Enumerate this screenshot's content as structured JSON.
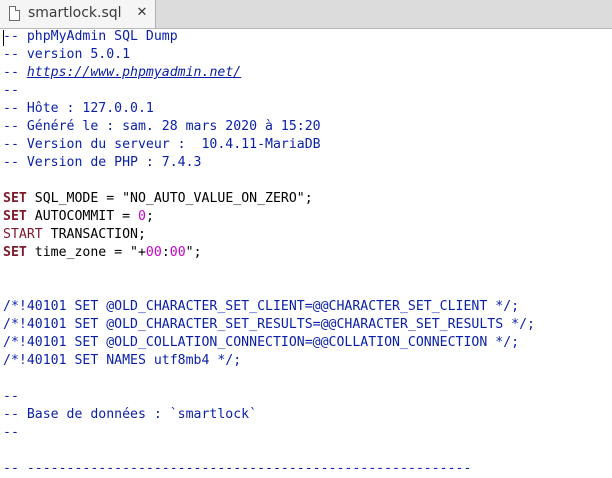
{
  "tab": {
    "title": "smartlock.sql",
    "close_glyph": "✕",
    "icon": "text-file-icon"
  },
  "colors": {
    "comment": "#0a1fa8",
    "keyword": "#7d1a2b",
    "number": "#c900c9",
    "text": "#000000"
  },
  "editor": {
    "lines": [
      [
        {
          "t": "-- phpMyAdmin SQL Dump",
          "s": "c"
        }
      ],
      [
        {
          "t": "-- version 5.0.1",
          "s": "c"
        }
      ],
      [
        {
          "t": "-- ",
          "s": "c"
        },
        {
          "t": "https://www.phpmyadmin.net/",
          "s": "u"
        }
      ],
      [
        {
          "t": "--",
          "s": "c"
        }
      ],
      [
        {
          "t": "-- Hôte : 127.0.0.1",
          "s": "c"
        }
      ],
      [
        {
          "t": "-- Généré le : sam. 28 mars 2020 à 15:20",
          "s": "c"
        }
      ],
      [
        {
          "t": "-- Version du serveur :  10.4.11-MariaDB",
          "s": "c"
        }
      ],
      [
        {
          "t": "-- Version de PHP : 7.4.3",
          "s": "c"
        }
      ],
      [],
      [
        {
          "t": "SET",
          "s": "kw"
        },
        {
          "t": " SQL_MODE = \"NO_AUTO_VALUE_ON_ZERO\";",
          "s": ""
        }
      ],
      [
        {
          "t": "SET",
          "s": "kw"
        },
        {
          "t": " AUTOCOMMIT = ",
          "s": ""
        },
        {
          "t": "0",
          "s": "n"
        },
        {
          "t": ";",
          "s": ""
        }
      ],
      [
        {
          "t": "START",
          "s": "kw2"
        },
        {
          "t": " TRANSACTION;",
          "s": ""
        }
      ],
      [
        {
          "t": "SET",
          "s": "kw"
        },
        {
          "t": " time_zone = \"+",
          "s": ""
        },
        {
          "t": "00",
          "s": "n"
        },
        {
          "t": ":",
          "s": ""
        },
        {
          "t": "00",
          "s": "n"
        },
        {
          "t": "\";",
          "s": ""
        }
      ],
      [],
      [],
      [
        {
          "t": "/*!40101 SET @OLD_CHARACTER_SET_CLIENT=@@CHARACTER_SET_CLIENT */;",
          "s": "c"
        }
      ],
      [
        {
          "t": "/*!40101 SET @OLD_CHARACTER_SET_RESULTS=@@CHARACTER_SET_RESULTS */;",
          "s": "c"
        }
      ],
      [
        {
          "t": "/*!40101 SET @OLD_COLLATION_CONNECTION=@@COLLATION_CONNECTION */;",
          "s": "c"
        }
      ],
      [
        {
          "t": "/*!40101 SET NAMES utf8mb4 */;",
          "s": "c"
        }
      ],
      [],
      [
        {
          "t": "--",
          "s": "c"
        }
      ],
      [
        {
          "t": "-- Base de données : `smartlock`",
          "s": "c"
        }
      ],
      [
        {
          "t": "--",
          "s": "c"
        }
      ],
      [],
      [
        {
          "t": "-- --------------------------------------------------------",
          "s": "c"
        }
      ]
    ]
  }
}
